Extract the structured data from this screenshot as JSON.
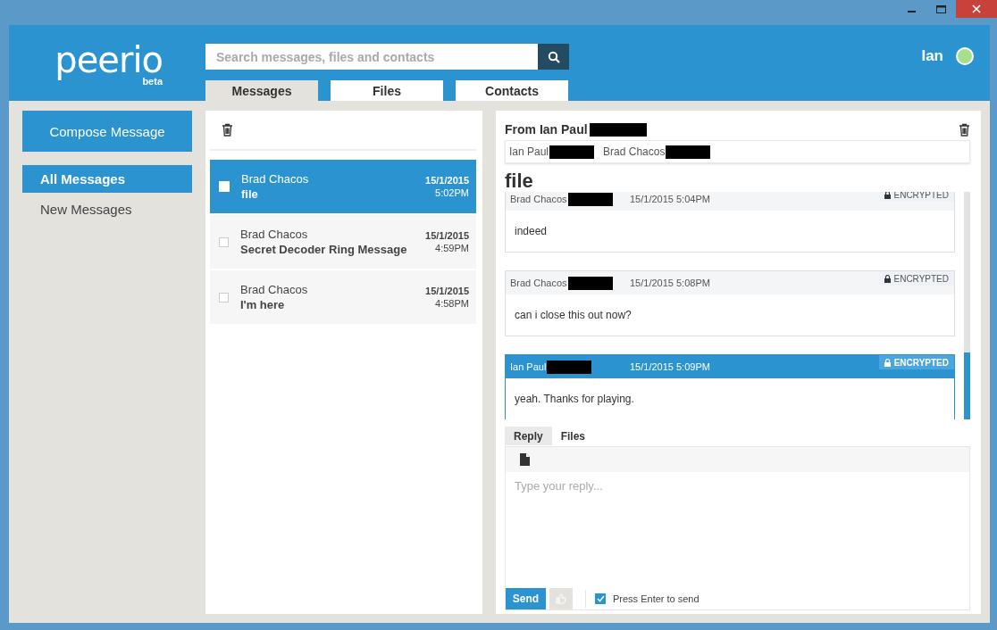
{
  "app": {
    "logo": "peerio",
    "logo_tag": "beta"
  },
  "search": {
    "placeholder": "Search messages, files and contacts"
  },
  "tabs": [
    {
      "label": "Messages",
      "selected": true
    },
    {
      "label": "Files",
      "selected": false
    },
    {
      "label": "Contacts",
      "selected": false
    }
  ],
  "user": {
    "name": "Ian"
  },
  "sidebar": {
    "compose_button": "Compose Message",
    "items": [
      {
        "label": "All Messages",
        "selected": true
      },
      {
        "label": "New Messages",
        "selected": false
      }
    ]
  },
  "message_list": {
    "rows": [
      {
        "sender": "Brad Chacos",
        "subject": "file",
        "date": "15/1/2015",
        "time": "5:02PM",
        "selected": true,
        "checked": false
      },
      {
        "sender": "Brad Chacos",
        "subject": "Secret Decoder Ring Message",
        "date": "15/1/2015",
        "time": "4:59PM",
        "selected": false,
        "checked": false
      },
      {
        "sender": "Brad Chacos",
        "subject": "I'm here",
        "date": "15/1/2015",
        "time": "4:58PM",
        "selected": false,
        "checked": false
      }
    ]
  },
  "conversation": {
    "from": "From Ian Paul",
    "from_redacted": true,
    "participants": [
      {
        "name": "Ian Paul",
        "redacted": true
      },
      {
        "name": "Brad Chacos",
        "redacted": true
      }
    ],
    "subject": "file",
    "messages": [
      {
        "sender": "Brad Chacos",
        "redacted": true,
        "timestamp": "15/1/2015 5:04PM",
        "badge": "ENCRYPTED",
        "body": "indeed",
        "selected": false
      },
      {
        "sender": "Brad Chacos",
        "redacted": true,
        "timestamp": "15/1/2015 5:08PM",
        "badge": "ENCRYPTED",
        "body": "can i close this out now?",
        "selected": false
      },
      {
        "sender": "Ian Paul",
        "redacted": true,
        "timestamp": "15/1/2015 5:09PM",
        "badge": "ENCRYPTED",
        "body": "yeah. Thanks for playing.",
        "selected": true
      }
    ]
  },
  "reply": {
    "tabs": [
      {
        "label": "Reply",
        "selected": true
      },
      {
        "label": "Files",
        "selected": false
      }
    ],
    "placeholder": "Type your reply...",
    "send_button": "Send",
    "enter_to_send": {
      "label": "Press Enter to send",
      "checked": true
    }
  }
}
